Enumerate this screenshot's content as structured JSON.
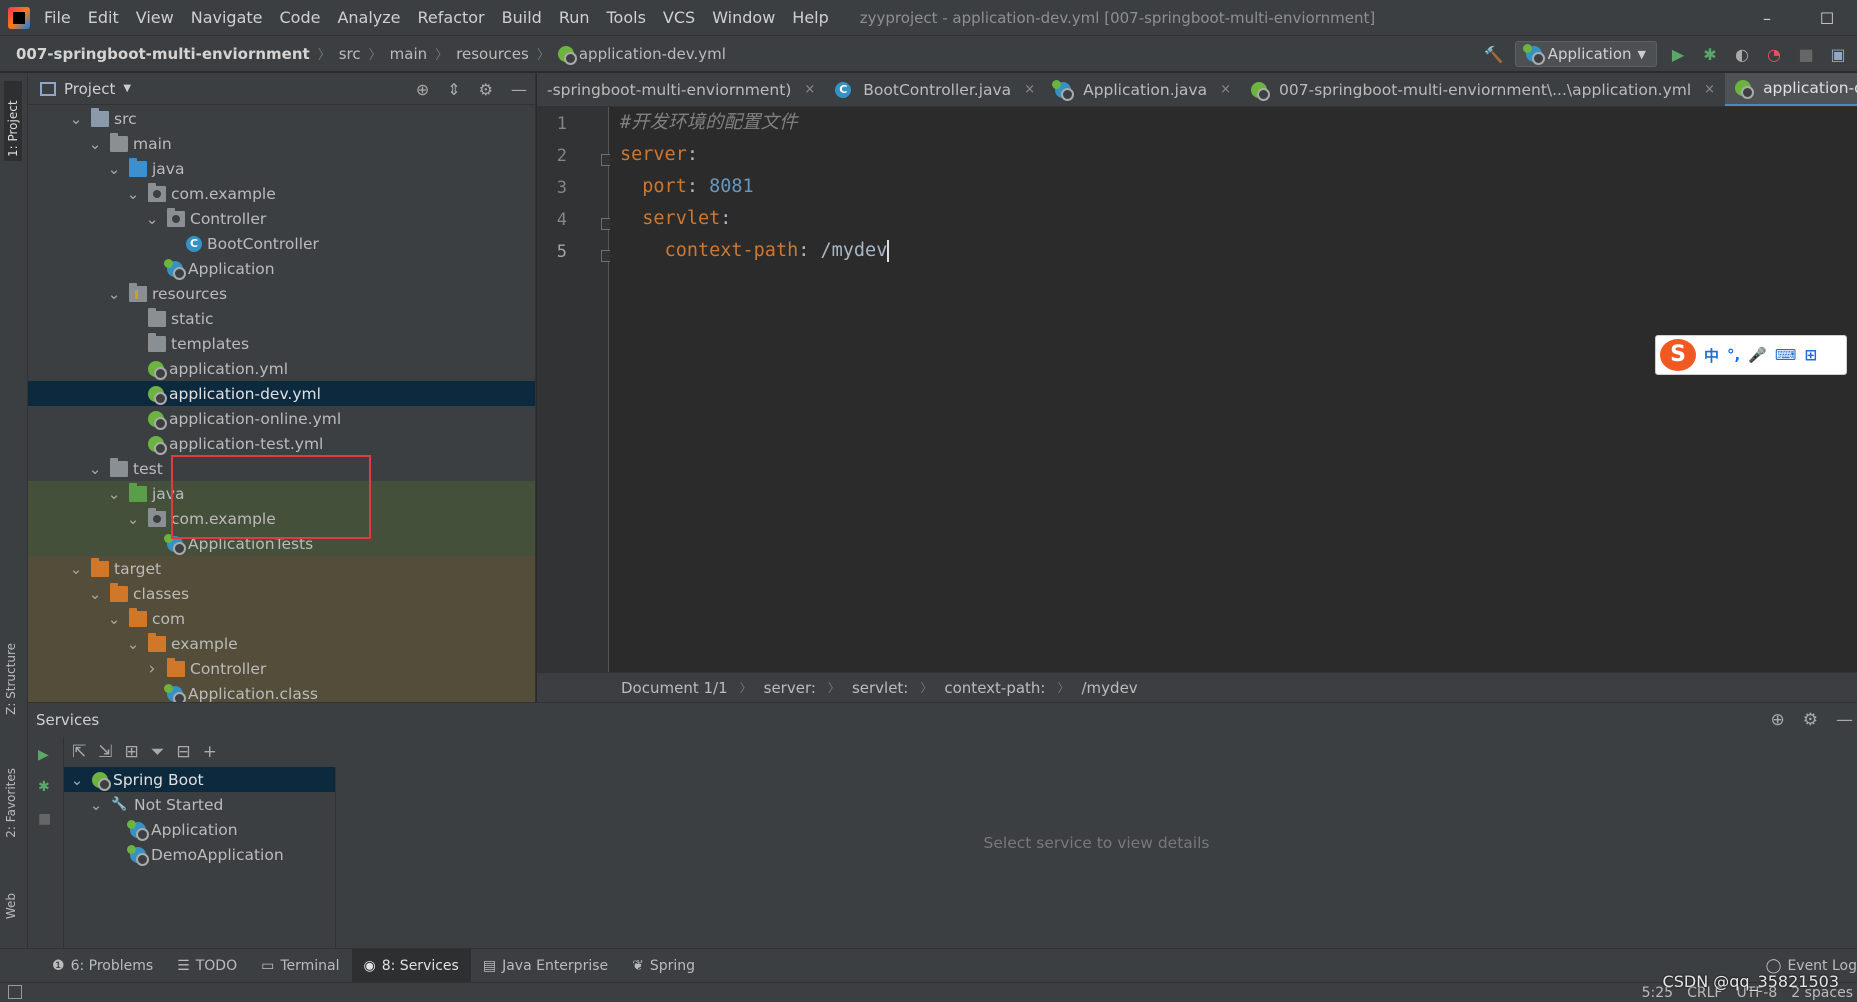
{
  "menubar": {
    "items": [
      "File",
      "Edit",
      "View",
      "Navigate",
      "Code",
      "Analyze",
      "Refactor",
      "Build",
      "Run",
      "Tools",
      "VCS",
      "Window",
      "Help"
    ],
    "window_title": "zyyproject - application-dev.yml [007-springboot-multi-enviornment]",
    "minimize": "–",
    "maximize": "☐"
  },
  "navbar": {
    "crumbs": [
      "007-springboot-multi-enviornment",
      "src",
      "main",
      "resources",
      "application-dev.yml"
    ],
    "run_config": "Application"
  },
  "left_strip": {
    "project_tab": "1: Project",
    "structure_tab": "Z: Structure",
    "favorites_tab": "2: Favorites",
    "web_tab": "Web"
  },
  "project": {
    "title": "Project",
    "tree": [
      {
        "label": "src",
        "depth": 1,
        "icon": "folder-src",
        "expanded": true
      },
      {
        "label": "main",
        "depth": 2,
        "icon": "folder",
        "expanded": true
      },
      {
        "label": "java",
        "depth": 3,
        "icon": "folder-blue",
        "expanded": true
      },
      {
        "label": "com.example",
        "depth": 4,
        "icon": "package",
        "expanded": true
      },
      {
        "label": "Controller",
        "depth": 5,
        "icon": "package",
        "expanded": true
      },
      {
        "label": "BootController",
        "depth": 6,
        "icon": "class"
      },
      {
        "label": "Application",
        "depth": 5,
        "icon": "spring-app"
      },
      {
        "label": "resources",
        "depth": 3,
        "icon": "folder-res",
        "expanded": true
      },
      {
        "label": "static",
        "depth": 4,
        "icon": "folder"
      },
      {
        "label": "templates",
        "depth": 4,
        "icon": "folder"
      },
      {
        "label": "application.yml",
        "depth": 4,
        "icon": "spring-yml"
      },
      {
        "label": "application-dev.yml",
        "depth": 4,
        "icon": "spring-yml",
        "selected": true
      },
      {
        "label": "application-online.yml",
        "depth": 4,
        "icon": "spring-yml"
      },
      {
        "label": "application-test.yml",
        "depth": 4,
        "icon": "spring-yml"
      },
      {
        "label": "test",
        "depth": 2,
        "icon": "folder",
        "expanded": true
      },
      {
        "label": "java",
        "depth": 3,
        "icon": "folder-green",
        "expanded": true,
        "band": "green"
      },
      {
        "label": "com.example",
        "depth": 4,
        "icon": "package",
        "expanded": true,
        "band": "green"
      },
      {
        "label": "ApplicationTests",
        "depth": 5,
        "icon": "spring-app",
        "band": "green"
      },
      {
        "label": "target",
        "depth": 1,
        "icon": "folder-orange",
        "expanded": true,
        "band": "orange"
      },
      {
        "label": "classes",
        "depth": 2,
        "icon": "folder-orange",
        "expanded": true,
        "band": "orange"
      },
      {
        "label": "com",
        "depth": 3,
        "icon": "folder-orange",
        "expanded": true,
        "band": "orange"
      },
      {
        "label": "example",
        "depth": 4,
        "icon": "folder-orange",
        "expanded": true,
        "band": "orange"
      },
      {
        "label": "Controller",
        "depth": 5,
        "icon": "folder-orange",
        "expanded": false,
        "band": "orange"
      },
      {
        "label": "Application.class",
        "depth": 5,
        "icon": "spring-app",
        "band": "orange"
      }
    ]
  },
  "editor": {
    "tabs": [
      {
        "label": "-springboot-multi-enviornment)",
        "icon": "none"
      },
      {
        "label": "BootController.java",
        "icon": "class"
      },
      {
        "label": "Application.java",
        "icon": "spring-app"
      },
      {
        "label": "007-springboot-multi-enviornment\\...\\application.yml",
        "icon": "spring-yml"
      },
      {
        "label": "application-dev.yml",
        "icon": "spring-yml",
        "active": true
      }
    ],
    "line_numbers": [
      "1",
      "2",
      "3",
      "4",
      "5"
    ],
    "lines": {
      "l1_comment": "#开发环境的配置文件",
      "l2_key": "server",
      "l3_key": "port",
      "l3_value": "8081",
      "l4_key": "servlet",
      "l5_key": "context-path",
      "l5_value": "/mydev"
    },
    "breadcrumbs": [
      "Document 1/1",
      "server:",
      "servlet:",
      "context-path:",
      "/mydev"
    ]
  },
  "ime": {
    "logo": "S",
    "items": [
      "中",
      "°,",
      "🎤",
      "⌨",
      "⊞"
    ]
  },
  "services": {
    "title": "Services",
    "tree": [
      {
        "label": "Spring Boot",
        "depth": 0,
        "icon": "spring",
        "expanded": true,
        "selected": true
      },
      {
        "label": "Not Started",
        "depth": 1,
        "icon": "wrench",
        "expanded": true
      },
      {
        "label": "Application",
        "depth": 2,
        "icon": "spring-app"
      },
      {
        "label": "DemoApplication",
        "depth": 2,
        "icon": "spring-app"
      }
    ],
    "empty_message": "Select service to view details"
  },
  "bottom_tabs": [
    {
      "label": "6: Problems",
      "icon": "problems-icon"
    },
    {
      "label": "TODO",
      "icon": "todo-icon"
    },
    {
      "label": "Terminal",
      "icon": "terminal-icon"
    },
    {
      "label": "8: Services",
      "icon": "services-icon",
      "active": true
    },
    {
      "label": "Java Enterprise",
      "icon": "java-enterprise-icon"
    },
    {
      "label": "Spring",
      "icon": "spring-icon"
    }
  ],
  "event_log": "Event Log",
  "status": {
    "position": "5:25",
    "line_sep": "CRLF",
    "encoding": "UTF-8",
    "indent": "2 spaces"
  },
  "watermark": "CSDN @qq_35821503",
  "colors": {
    "selection": "#0d293e",
    "highlight_box": "#e23b3b",
    "spring_green": "#6db33f",
    "accent": "#4a88c7"
  }
}
